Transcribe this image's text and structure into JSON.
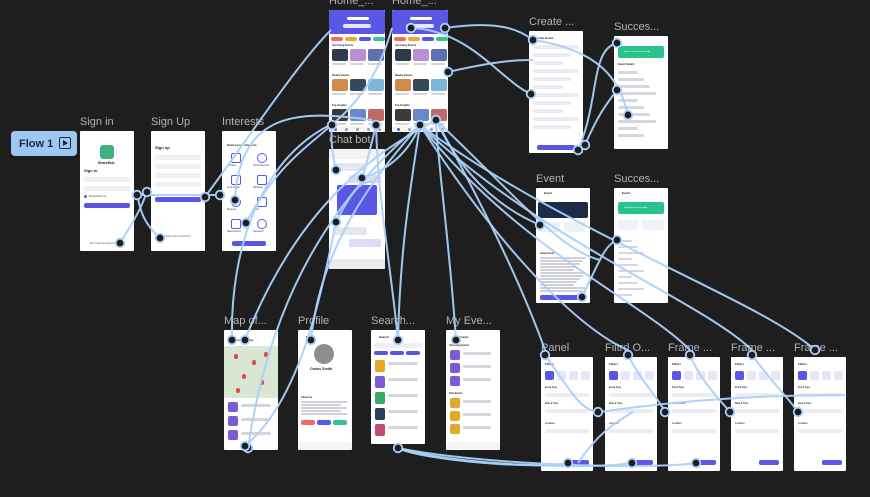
{
  "flow": {
    "label": "Flow 1",
    "icon": "play-frame-icon"
  },
  "frames": [
    {
      "id": "sign-in",
      "title": "Sign in"
    },
    {
      "id": "sign-up",
      "title": "Sign Up"
    },
    {
      "id": "interests",
      "title": "Interests"
    },
    {
      "id": "home-1",
      "title": "Home_..."
    },
    {
      "id": "home-2",
      "title": "Home_..."
    },
    {
      "id": "chat",
      "title": "Chat bot"
    },
    {
      "id": "create",
      "title": "Create ..."
    },
    {
      "id": "success-1",
      "title": "Succes..."
    },
    {
      "id": "event",
      "title": "Event"
    },
    {
      "id": "success-2",
      "title": "Succes..."
    },
    {
      "id": "map",
      "title": "Map of..."
    },
    {
      "id": "profile",
      "title": "Profile"
    },
    {
      "id": "search",
      "title": "Search..."
    },
    {
      "id": "my-events",
      "title": "My Eve..."
    },
    {
      "id": "panel",
      "title": "Panel"
    },
    {
      "id": "filter",
      "title": "Filtrd O..."
    },
    {
      "id": "frame-a",
      "title": "Frame ..."
    },
    {
      "id": "frame-b",
      "title": "Frame ..."
    },
    {
      "id": "frame-c",
      "title": "Frame ..."
    }
  ],
  "screens": {
    "sign_in": {
      "brand": "ShareHub",
      "heading": "Sign in",
      "remember": "Remember me",
      "button": "Sign in",
      "footer": "Don't have an account?"
    },
    "sign_up": {
      "heading": "Sign up",
      "button": "Sign up",
      "footer": "Already have an account?"
    },
    "interests": {
      "heading": "Select your interests",
      "items": [
        "Software",
        "Social Sciences",
        "Art & Design",
        "Marketing",
        "Business",
        "Cloud",
        "Data Analysis",
        "Teamwork"
      ],
      "button": "Let's go"
    },
    "home": {
      "sections": [
        "Upcoming Events",
        "Nearby Events",
        "Top Insights",
        "Recommended"
      ],
      "chip_labels": [
        "All",
        "Online",
        "Nearby",
        "Free"
      ]
    },
    "create": {
      "title": "Create Event",
      "button": "Create Event"
    },
    "success_1": {
      "banner": "Event created successfully",
      "title": "Event Details"
    },
    "event": {
      "title": "Event",
      "about": "About Event",
      "button": "Register"
    },
    "success_2": {
      "banner": "Registered successfully",
      "title": "Event"
    },
    "map": {
      "title": "Events Nearby"
    },
    "profile": {
      "title": "Profile",
      "name": "Carlos Smith",
      "about": "About me",
      "tags": [
        "Design",
        "AI",
        "Marketing"
      ]
    },
    "search": {
      "title": "Search"
    },
    "my_events": {
      "title": "My Events",
      "upcoming": "Upcoming Events",
      "past": "Past Events"
    },
    "filters": {
      "title": "Filters",
      "type": "Event Type",
      "date": "Date & Time",
      "location": "Location",
      "apply": "Apply"
    }
  },
  "colors": {
    "accent": "#5b57e6",
    "wire": "#a9d1fa",
    "canvas": "#1e1e1e",
    "success": "#29c48a"
  }
}
